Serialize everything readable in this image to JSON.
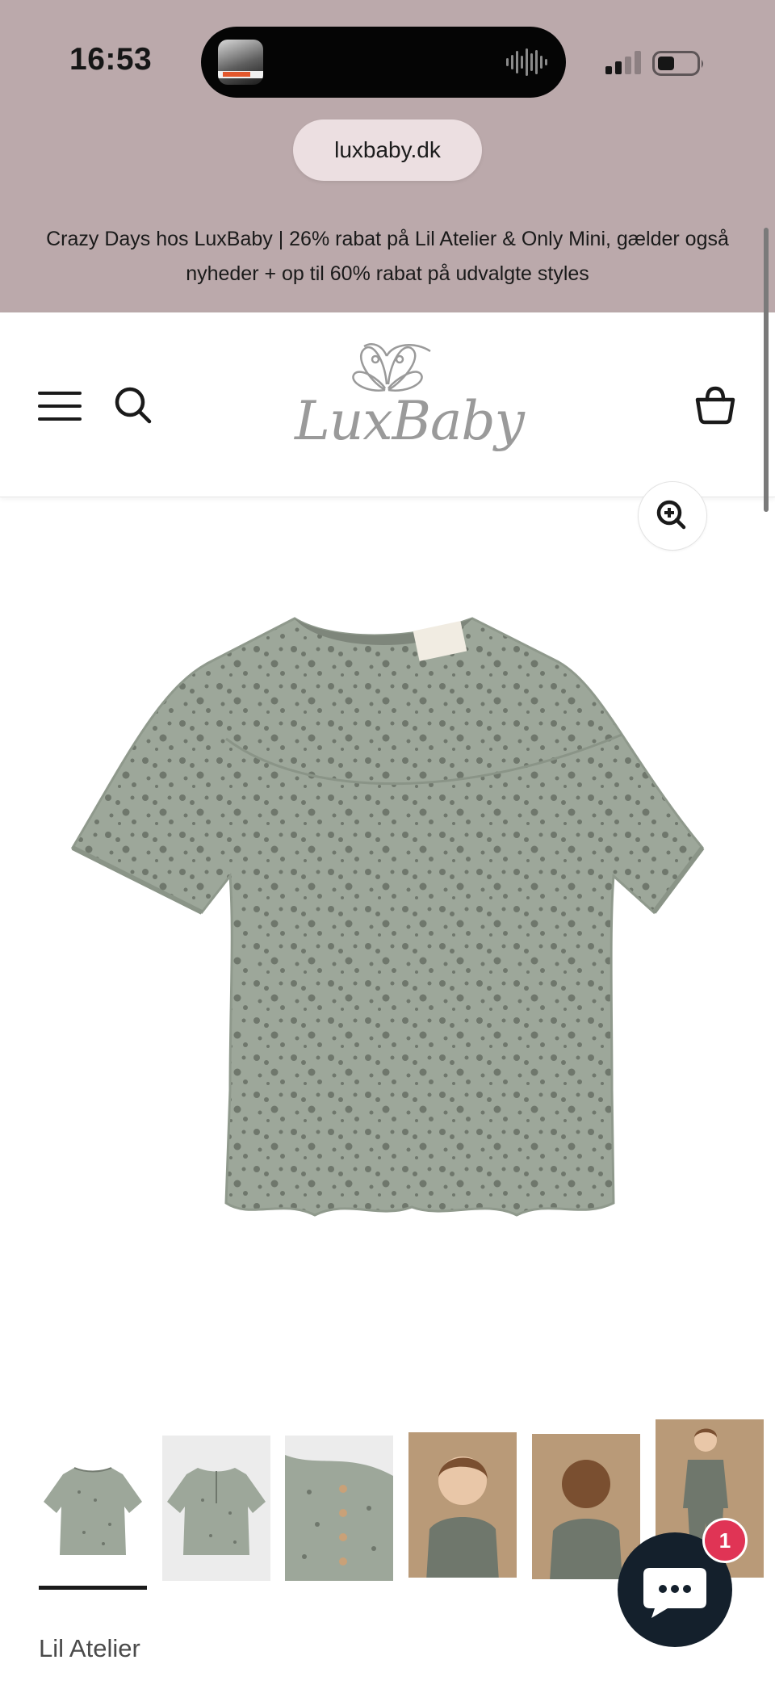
{
  "status_bar": {
    "time": "16:53"
  },
  "browser": {
    "url": "luxbaby.dk"
  },
  "promo": {
    "text": "Crazy Days hos LuxBaby | 26% rabat på Lil Atelier & Only Mini, gælder også nyheder + op til 60% rabat på udvalgte styles"
  },
  "header": {
    "logo_text": "LuxBaby",
    "menu_icon": "hamburger-icon",
    "search_icon": "search-icon",
    "cart_icon": "basket-icon"
  },
  "product": {
    "brand": "Lil Atelier",
    "image_color": "#9da79a",
    "thumbnails": [
      {
        "name": "front-view",
        "active": true
      },
      {
        "name": "back-view",
        "active": false
      },
      {
        "name": "detail-view",
        "active": false
      },
      {
        "name": "model-front",
        "active": false
      },
      {
        "name": "model-back",
        "active": false
      },
      {
        "name": "model-full",
        "active": false
      }
    ]
  },
  "chat": {
    "badge_count": "1"
  },
  "colors": {
    "top_bg": "#bba9ab",
    "url_pill": "#ecdfe1",
    "chat_bg": "#14202c",
    "badge": "#e03455"
  }
}
